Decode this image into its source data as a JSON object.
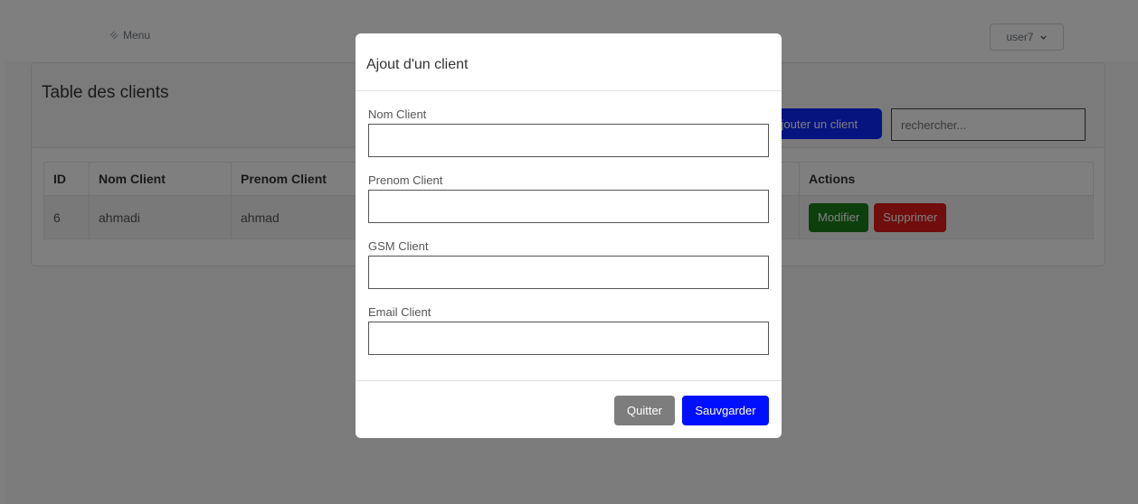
{
  "header": {
    "menu_label": "Menu",
    "user_name": "user7"
  },
  "card": {
    "title": "Table des clients",
    "add_button": "Ajouter un client",
    "search_placeholder": "rechercher..."
  },
  "table": {
    "columns": [
      "ID",
      "Nom Client",
      "Prenom Client",
      "Actions"
    ],
    "rows": [
      {
        "id": "6",
        "nom": "ahmadi",
        "prenom": "ahmad",
        "edit": "Modifier",
        "delete": "Supprimer"
      }
    ]
  },
  "modal": {
    "title": "Ajout d'un client",
    "fields": [
      {
        "label": "Nom Client",
        "value": ""
      },
      {
        "label": "Prenom Client",
        "value": ""
      },
      {
        "label": "GSM Client",
        "value": ""
      },
      {
        "label": "Email Client",
        "value": ""
      }
    ],
    "quit_button": "Quitter",
    "save_button": "Sauvgarder"
  },
  "colors": {
    "primary": "#0010ff",
    "success": "#1a7f1a",
    "danger": "#e01b1b",
    "secondary": "#7d7d7d"
  }
}
